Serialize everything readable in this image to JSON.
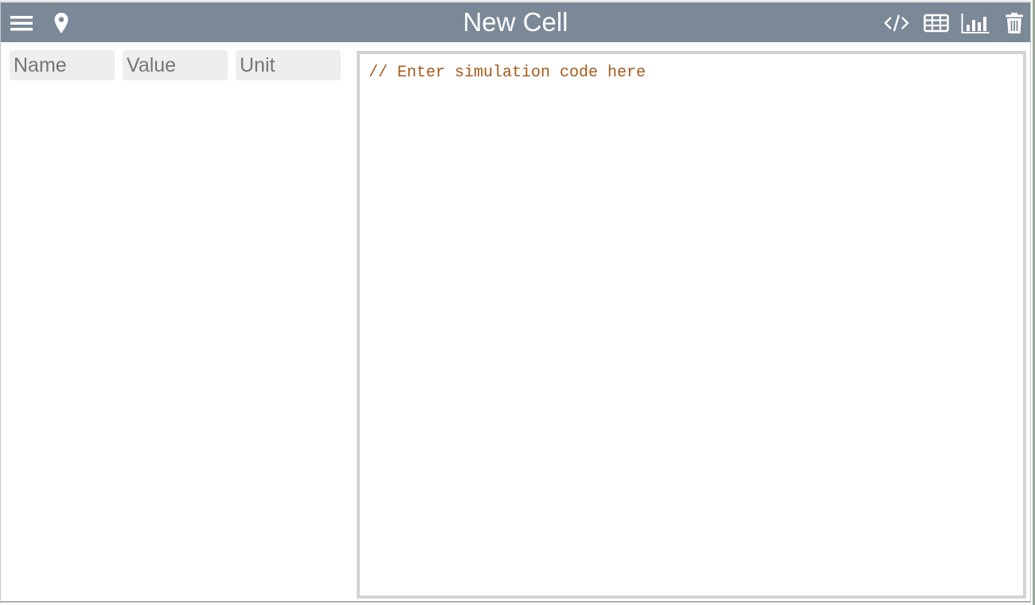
{
  "header": {
    "title": "New Cell"
  },
  "fields": {
    "name_placeholder": "Name",
    "value_placeholder": "Value",
    "unit_placeholder": "Unit"
  },
  "editor": {
    "code": "// Enter simulation code here"
  },
  "colors": {
    "header_bg": "#7b8898",
    "code_comment": "#a55a1a",
    "field_bg": "#eeeeee"
  }
}
